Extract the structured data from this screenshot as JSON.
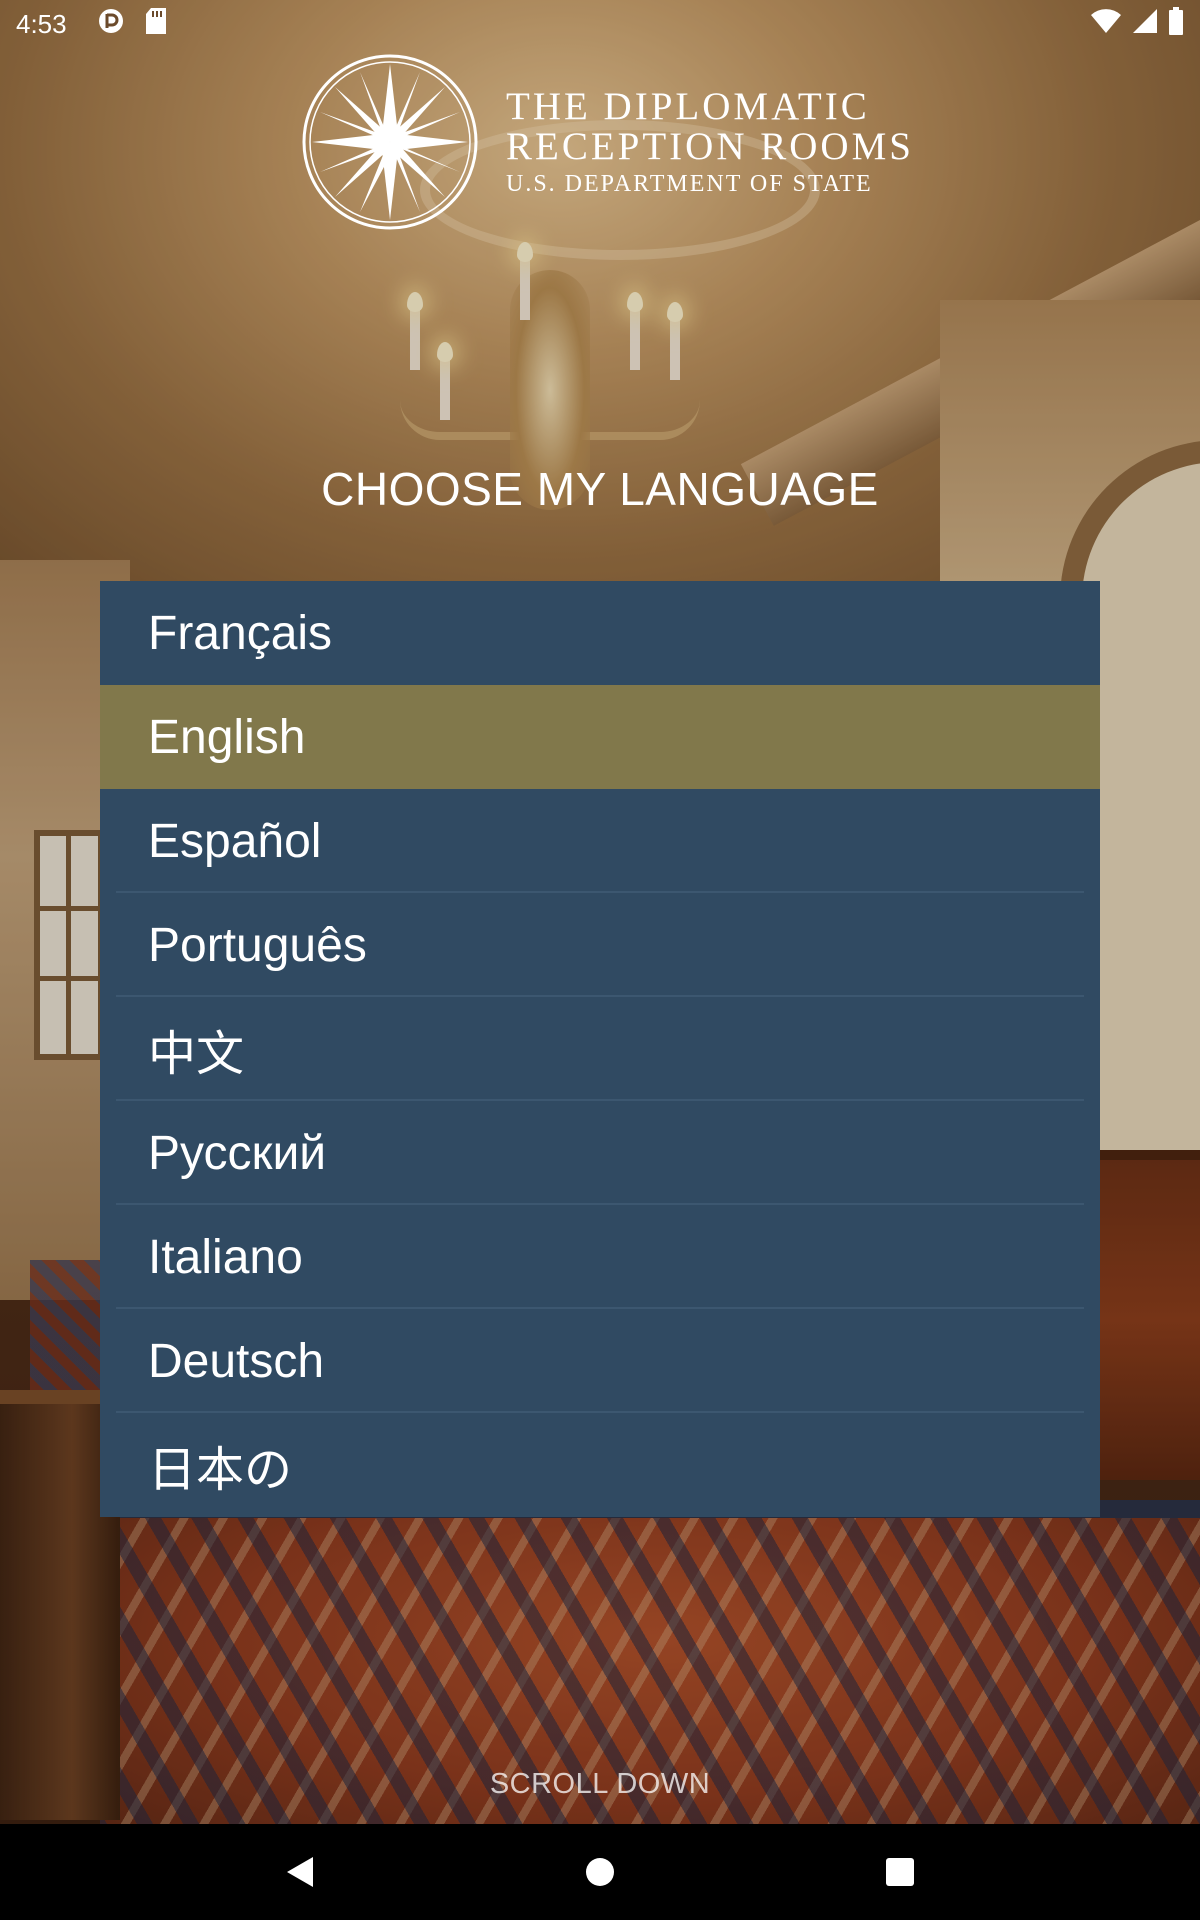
{
  "status_bar": {
    "time": "4:53",
    "left_icons": [
      "vpn-icon",
      "sd-card-icon"
    ],
    "right_icons": [
      "wifi-icon",
      "signal-icon",
      "battery-icon"
    ]
  },
  "logo": {
    "line1": "THE DIPLOMATIC",
    "line2": "RECEPTION ROOMS",
    "line3": "U.S. DEPARTMENT OF STATE",
    "icon": "compass-star-icon"
  },
  "heading": "CHOOSE MY LANGUAGE",
  "languages": [
    {
      "label": "Français",
      "selected": false
    },
    {
      "label": "English",
      "selected": true
    },
    {
      "label": "Español",
      "selected": false
    },
    {
      "label": "Português",
      "selected": false
    },
    {
      "label": "中文",
      "selected": false
    },
    {
      "label": "Русский",
      "selected": false
    },
    {
      "label": "Italiano",
      "selected": false
    },
    {
      "label": "Deutsch",
      "selected": false
    },
    {
      "label": "日本の",
      "selected": false
    }
  ],
  "scroll_hint": "SCROLL DOWN",
  "nav_bar": {
    "buttons": [
      "back-icon",
      "home-icon",
      "recents-icon"
    ]
  },
  "colors": {
    "list_background": "#304a62",
    "selected_background": "#81784b",
    "divider": "#3c5770"
  }
}
